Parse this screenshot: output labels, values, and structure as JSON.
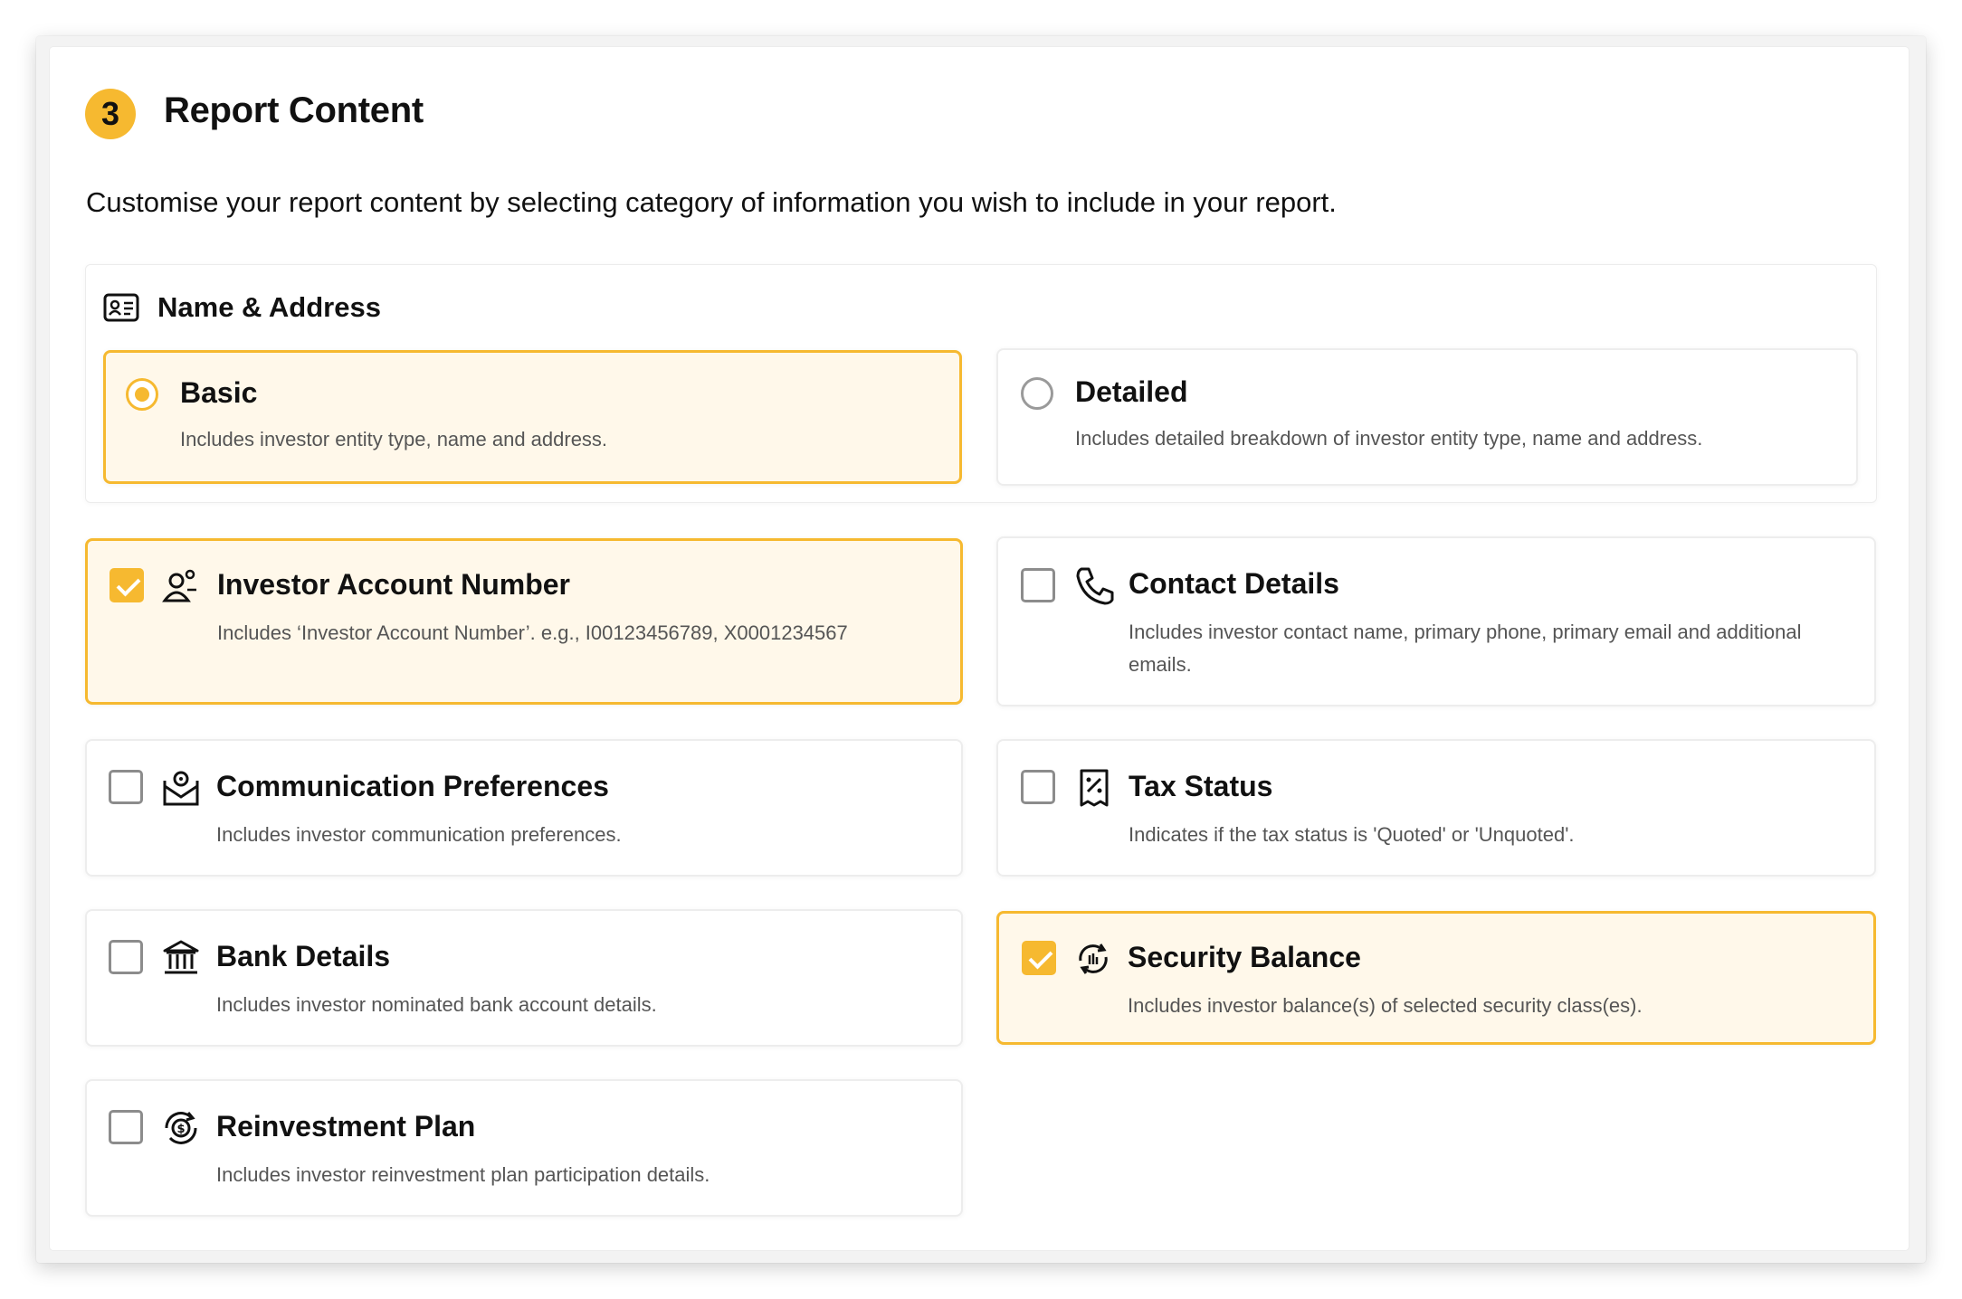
{
  "section": {
    "step": "3",
    "title": "Report Content",
    "intro": "Customise your report content by selecting category of information you wish to include in your report."
  },
  "name_address": {
    "label": "Name & Address",
    "options": [
      {
        "title": "Basic",
        "desc": "Includes investor entity type, name and address.",
        "selected": true
      },
      {
        "title": "Detailed",
        "desc": "Includes detailed breakdown of investor entity type, name and address.",
        "selected": false
      }
    ]
  },
  "categories": [
    {
      "id": "investor-account-number",
      "title": "Investor Account Number",
      "desc": "Includes ‘Investor Account Number’. e.g., I00123456789, X0001234567",
      "checked": true,
      "icon": "user-account-icon"
    },
    {
      "id": "contact-details",
      "title": "Contact Details",
      "desc": "Includes investor contact name, primary phone, primary email and additional emails.",
      "checked": false,
      "icon": "phone-icon"
    },
    {
      "id": "communication-preferences",
      "title": "Communication Preferences",
      "desc": "Includes investor communication preferences.",
      "checked": false,
      "icon": "mail-settings-icon"
    },
    {
      "id": "tax-status",
      "title": "Tax Status",
      "desc": "Indicates if the tax status is 'Quoted' or 'Unquoted'.",
      "checked": false,
      "icon": "tax-receipt-icon"
    },
    {
      "id": "bank-details",
      "title": "Bank Details",
      "desc": "Includes investor nominated bank account details.",
      "checked": false,
      "icon": "bank-icon"
    },
    {
      "id": "security-balance",
      "title": "Security Balance",
      "desc": "Includes investor balance(s) of selected security class(es).",
      "checked": true,
      "icon": "balance-exchange-icon"
    },
    {
      "id": "reinvestment-plan",
      "title": "Reinvestment Plan",
      "desc": "Includes investor reinvestment plan participation details.",
      "checked": false,
      "icon": "reinvest-coin-icon"
    }
  ]
}
